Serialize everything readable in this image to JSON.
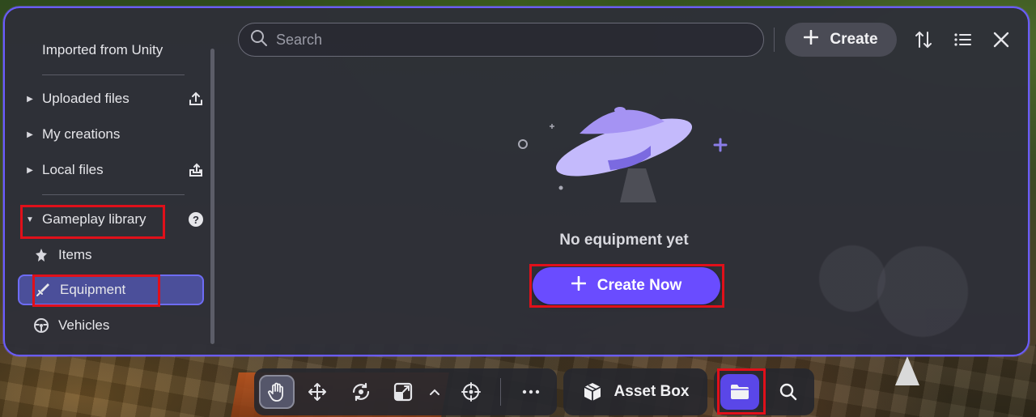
{
  "sidebar": {
    "title": "Imported from Unity",
    "items": [
      {
        "label": "Uploaded files",
        "icon": "upload-icon"
      },
      {
        "label": "My creations"
      },
      {
        "label": "Local files",
        "icon": "local-upload-icon"
      }
    ],
    "gameplay": {
      "label": "Gameplay library",
      "help_icon": "help-icon",
      "subitems": [
        {
          "label": "Items",
          "icon": "items-icon"
        },
        {
          "label": "Equipment",
          "icon": "sword-icon",
          "active": true
        },
        {
          "label": "Vehicles",
          "icon": "steering-wheel-icon"
        }
      ]
    }
  },
  "search": {
    "placeholder": "Search"
  },
  "toolbar_top": {
    "create_label": "Create"
  },
  "empty_state": {
    "message": "No equipment yet",
    "button_label": "Create Now"
  },
  "bottom_toolbar": {
    "tools": [
      "hand-icon",
      "move-icon",
      "rotate-icon",
      "scale-icon",
      "chevron-up-icon",
      "pivot-icon",
      "more-icon"
    ],
    "more_label": "···",
    "asset_box_label": "Asset Box"
  },
  "colors": {
    "accent": "#6a4cff",
    "panel_border": "#6a5cff",
    "highlight_box": "#e0101a"
  }
}
